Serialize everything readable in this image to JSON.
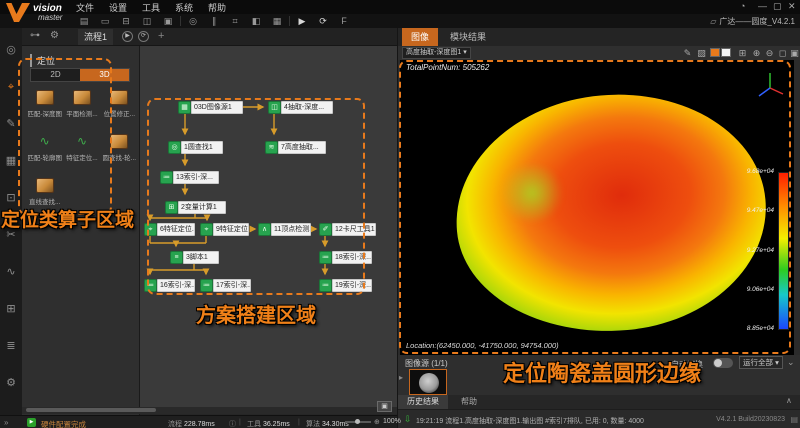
{
  "colors": {
    "accent": "#e87a1c",
    "node_green": "#27a34f",
    "arrow": "#d79b2a",
    "annotation_orange": "#f08018",
    "tab_active": "#c7671e",
    "swatch_white": "#f5f5f5"
  },
  "icons": {
    "caret_down": "▾",
    "chevron_down": "⌄",
    "chevron_up": "∧",
    "play": "▶",
    "loop": "⟳",
    "info": "ⓘ",
    "double_arrow": "»",
    "folder": "▱",
    "arrow_right": "▸",
    "download": "⇩",
    "zoom": "⊕",
    "add": "+"
  },
  "titlebar": {
    "logo": {
      "line1": "vision",
      "line2": "master"
    },
    "menus": [
      "文件",
      "设置",
      "工具",
      "系统",
      "帮助"
    ],
    "window_controls": {
      "monitor": "◔",
      "minimize": "—",
      "maximize": "▢",
      "close": "✕"
    }
  },
  "toolbar": {
    "icons": [
      {
        "name": "save",
        "glyph": "▤"
      },
      {
        "name": "open",
        "glyph": "▭"
      },
      {
        "name": "export",
        "glyph": "⊟"
      },
      {
        "name": "compare",
        "glyph": "◫"
      },
      {
        "name": "layout",
        "glyph": "▣"
      },
      {
        "name": "camera",
        "glyph": "◎"
      },
      {
        "name": "parallel",
        "glyph": "∥"
      },
      {
        "name": "grid",
        "glyph": "⌗"
      },
      {
        "name": "module",
        "glyph": "◧"
      },
      {
        "name": "data-queue",
        "glyph": "▦"
      },
      {
        "name": "run-once",
        "glyph": "▶"
      },
      {
        "name": "run-continuous",
        "glyph": "⟳"
      },
      {
        "name": "front-run",
        "glyph": "F"
      }
    ],
    "project_label": "广达——圆度_V4.2.1"
  },
  "left_strip": {
    "icons": [
      {
        "name": "camera-source",
        "glyph": "◎"
      },
      {
        "name": "locate",
        "glyph": "⌖"
      },
      {
        "name": "draw",
        "glyph": "✎"
      },
      {
        "name": "measure",
        "glyph": "▦"
      },
      {
        "name": "roi",
        "glyph": "⊡"
      },
      {
        "name": "clip",
        "glyph": "✂"
      },
      {
        "name": "curve",
        "glyph": "∿"
      },
      {
        "name": "calib",
        "glyph": "⊞"
      },
      {
        "name": "list",
        "glyph": "≣"
      },
      {
        "name": "settings",
        "glyph": "⚙"
      }
    ]
  },
  "flowbar": {
    "flow_icon": "⊶",
    "settings_icon": "⚙",
    "tab_label": "流程1"
  },
  "operator_panel": {
    "title": "定位",
    "tabs": [
      {
        "label": "2D"
      },
      {
        "label": "3D"
      }
    ],
    "items": [
      {
        "label": "匹配-深度图"
      },
      {
        "label": "平面检测..."
      },
      {
        "label": "位置修正..."
      },
      {
        "label": "匹配-轮廓图"
      },
      {
        "label": "特征定位..."
      },
      {
        "label": "圆查找-轮..."
      },
      {
        "label": "直线查找..."
      }
    ]
  },
  "flow": {
    "nodes": [
      {
        "label": "03D图像源1",
        "glyph": "▦"
      },
      {
        "label": "4抽取-深度...",
        "glyph": "◫"
      },
      {
        "label": "1圆查找1",
        "glyph": "◎"
      },
      {
        "label": "7高度抽取...",
        "glyph": "≋"
      },
      {
        "label": "13索引-深...",
        "glyph": "≔"
      },
      {
        "label": "2变量计算1",
        "glyph": "⊞"
      },
      {
        "label": "6特征定位...",
        "glyph": "⌖"
      },
      {
        "label": "9特征定位...",
        "glyph": "⌖"
      },
      {
        "label": "11顶点检测1",
        "glyph": "∧"
      },
      {
        "label": "12卡尺工具1",
        "glyph": "✐"
      },
      {
        "label": "3脚本1",
        "glyph": "≡"
      },
      {
        "label": "18索引-深...",
        "glyph": "≔"
      },
      {
        "label": "16索引-深...",
        "glyph": "≔"
      },
      {
        "label": "17索引-深...",
        "glyph": "≔"
      },
      {
        "label": "19索引-深...",
        "glyph": "≔"
      }
    ]
  },
  "annotations": {
    "operators": "定位类算子区域",
    "workspace": "方案搭建区域",
    "result": "定位陶瓷盖圆形边缘"
  },
  "viewer": {
    "tabs": [
      {
        "label": "图像"
      },
      {
        "label": "模块结果"
      }
    ],
    "source_select": "高度抽取-深度图1",
    "toolbar_icons": [
      {
        "name": "edit",
        "glyph": "✎"
      },
      {
        "name": "cursor",
        "glyph": "▨"
      },
      {
        "name": "fit",
        "glyph": "⊞"
      },
      {
        "name": "zoom-in",
        "glyph": "⊕"
      },
      {
        "name": "zoom-out",
        "glyph": "⊖"
      },
      {
        "name": "one-to-one",
        "glyph": "◻"
      },
      {
        "name": "fullscreen",
        "glyph": "▣"
      }
    ],
    "total_points": "TotalPointNum: 505262",
    "location": "Location:(62450.000, -41750.000, 94754.000)",
    "colorbar_ticks": [
      "9.68e+04",
      "9.47e+04",
      "9.27e+04",
      "9.06e+04",
      "8.85e+04"
    ]
  },
  "capture": {
    "image_source_label": "图像源 (1/1)",
    "auto_switch_label": "自动切换",
    "run_mode": "运行全部"
  },
  "results": {
    "tabs": [
      {
        "label": "历史结果"
      },
      {
        "label": "帮助"
      }
    ],
    "log": "19:21:19 流程1.高度抽取-深度图1.输出图 #索引7排队, 已用: 0, 数量: 4000",
    "version": "V4.2.1 Build20230823"
  },
  "statusbar": {
    "status": "硬件配置完成",
    "items": [
      {
        "label": "流程",
        "value": "228.78ms"
      },
      {
        "label": "工具",
        "value": "36.25ms"
      },
      {
        "label": "算法",
        "value": "34.30ms"
      }
    ],
    "zoom": "100%"
  }
}
